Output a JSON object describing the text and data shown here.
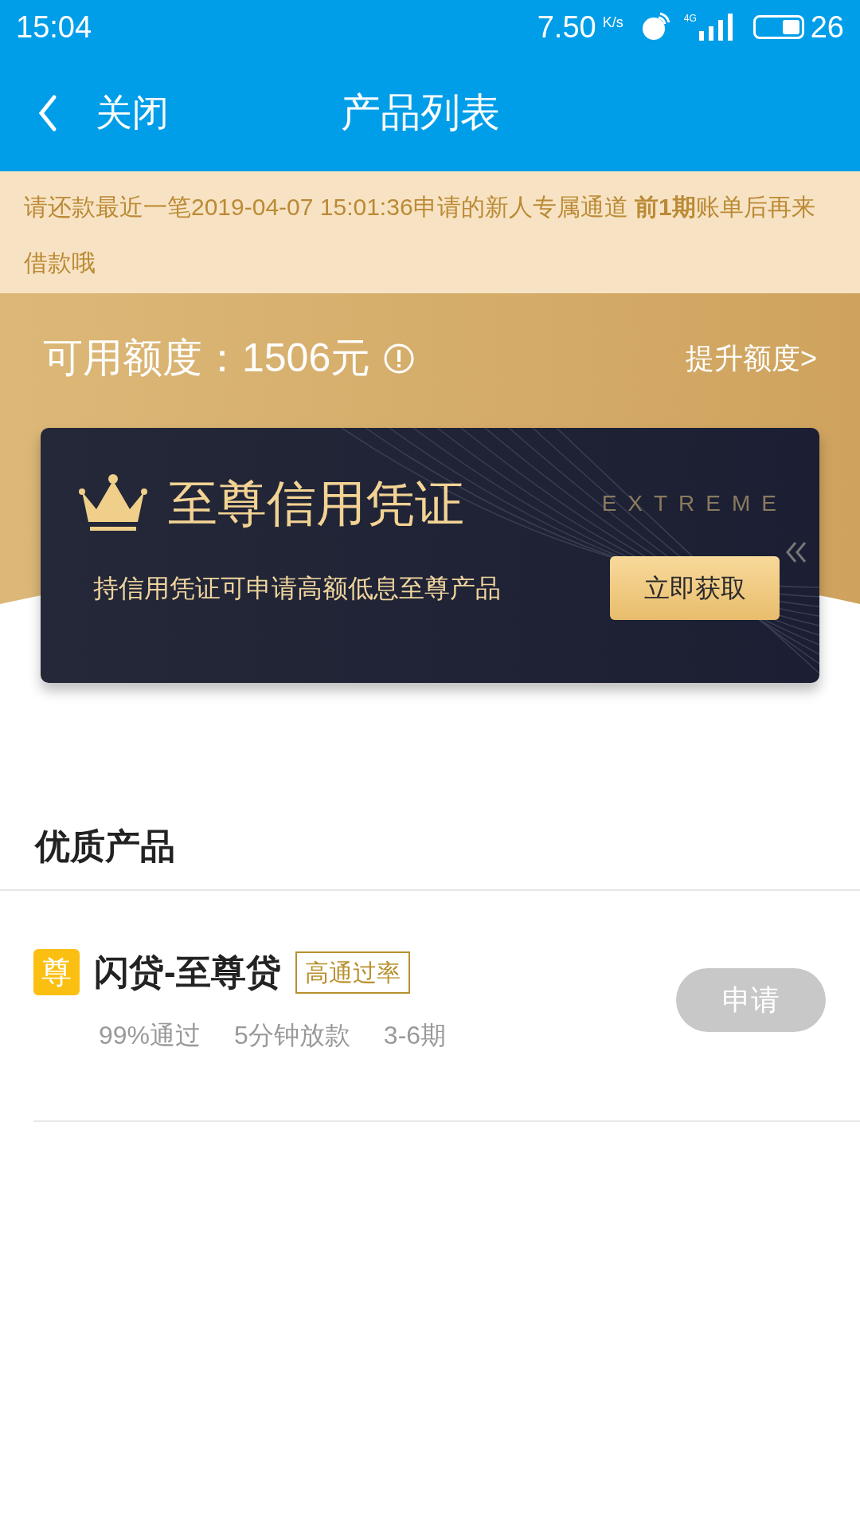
{
  "status_bar": {
    "time": "15:04",
    "speed": "7.50",
    "speed_unit": "K/s",
    "network": "4G",
    "battery": "26"
  },
  "header": {
    "back_label": "关闭",
    "title": "产品列表"
  },
  "notice": {
    "text": "请还款最近一笔2019-04-07 15:01:36申请的新人专属通道 **前1期**账单后再来借款哦"
  },
  "credit": {
    "label": "可用额度：1506元",
    "raise_link": "提升额度>"
  },
  "premium_card": {
    "title": "至尊信用凭证",
    "badge": "EXTREME",
    "description": "持信用凭证可申请高额低息至尊产品",
    "button": "立即获取"
  },
  "section": {
    "title": "优质产品"
  },
  "products": [
    {
      "icon_char": "尊",
      "name": "闪贷-至尊贷",
      "tag": "高通过率",
      "stats": [
        "99%通过",
        "5分钟放款",
        "3-6期"
      ],
      "apply_button": "申请",
      "disabled": true
    }
  ]
}
